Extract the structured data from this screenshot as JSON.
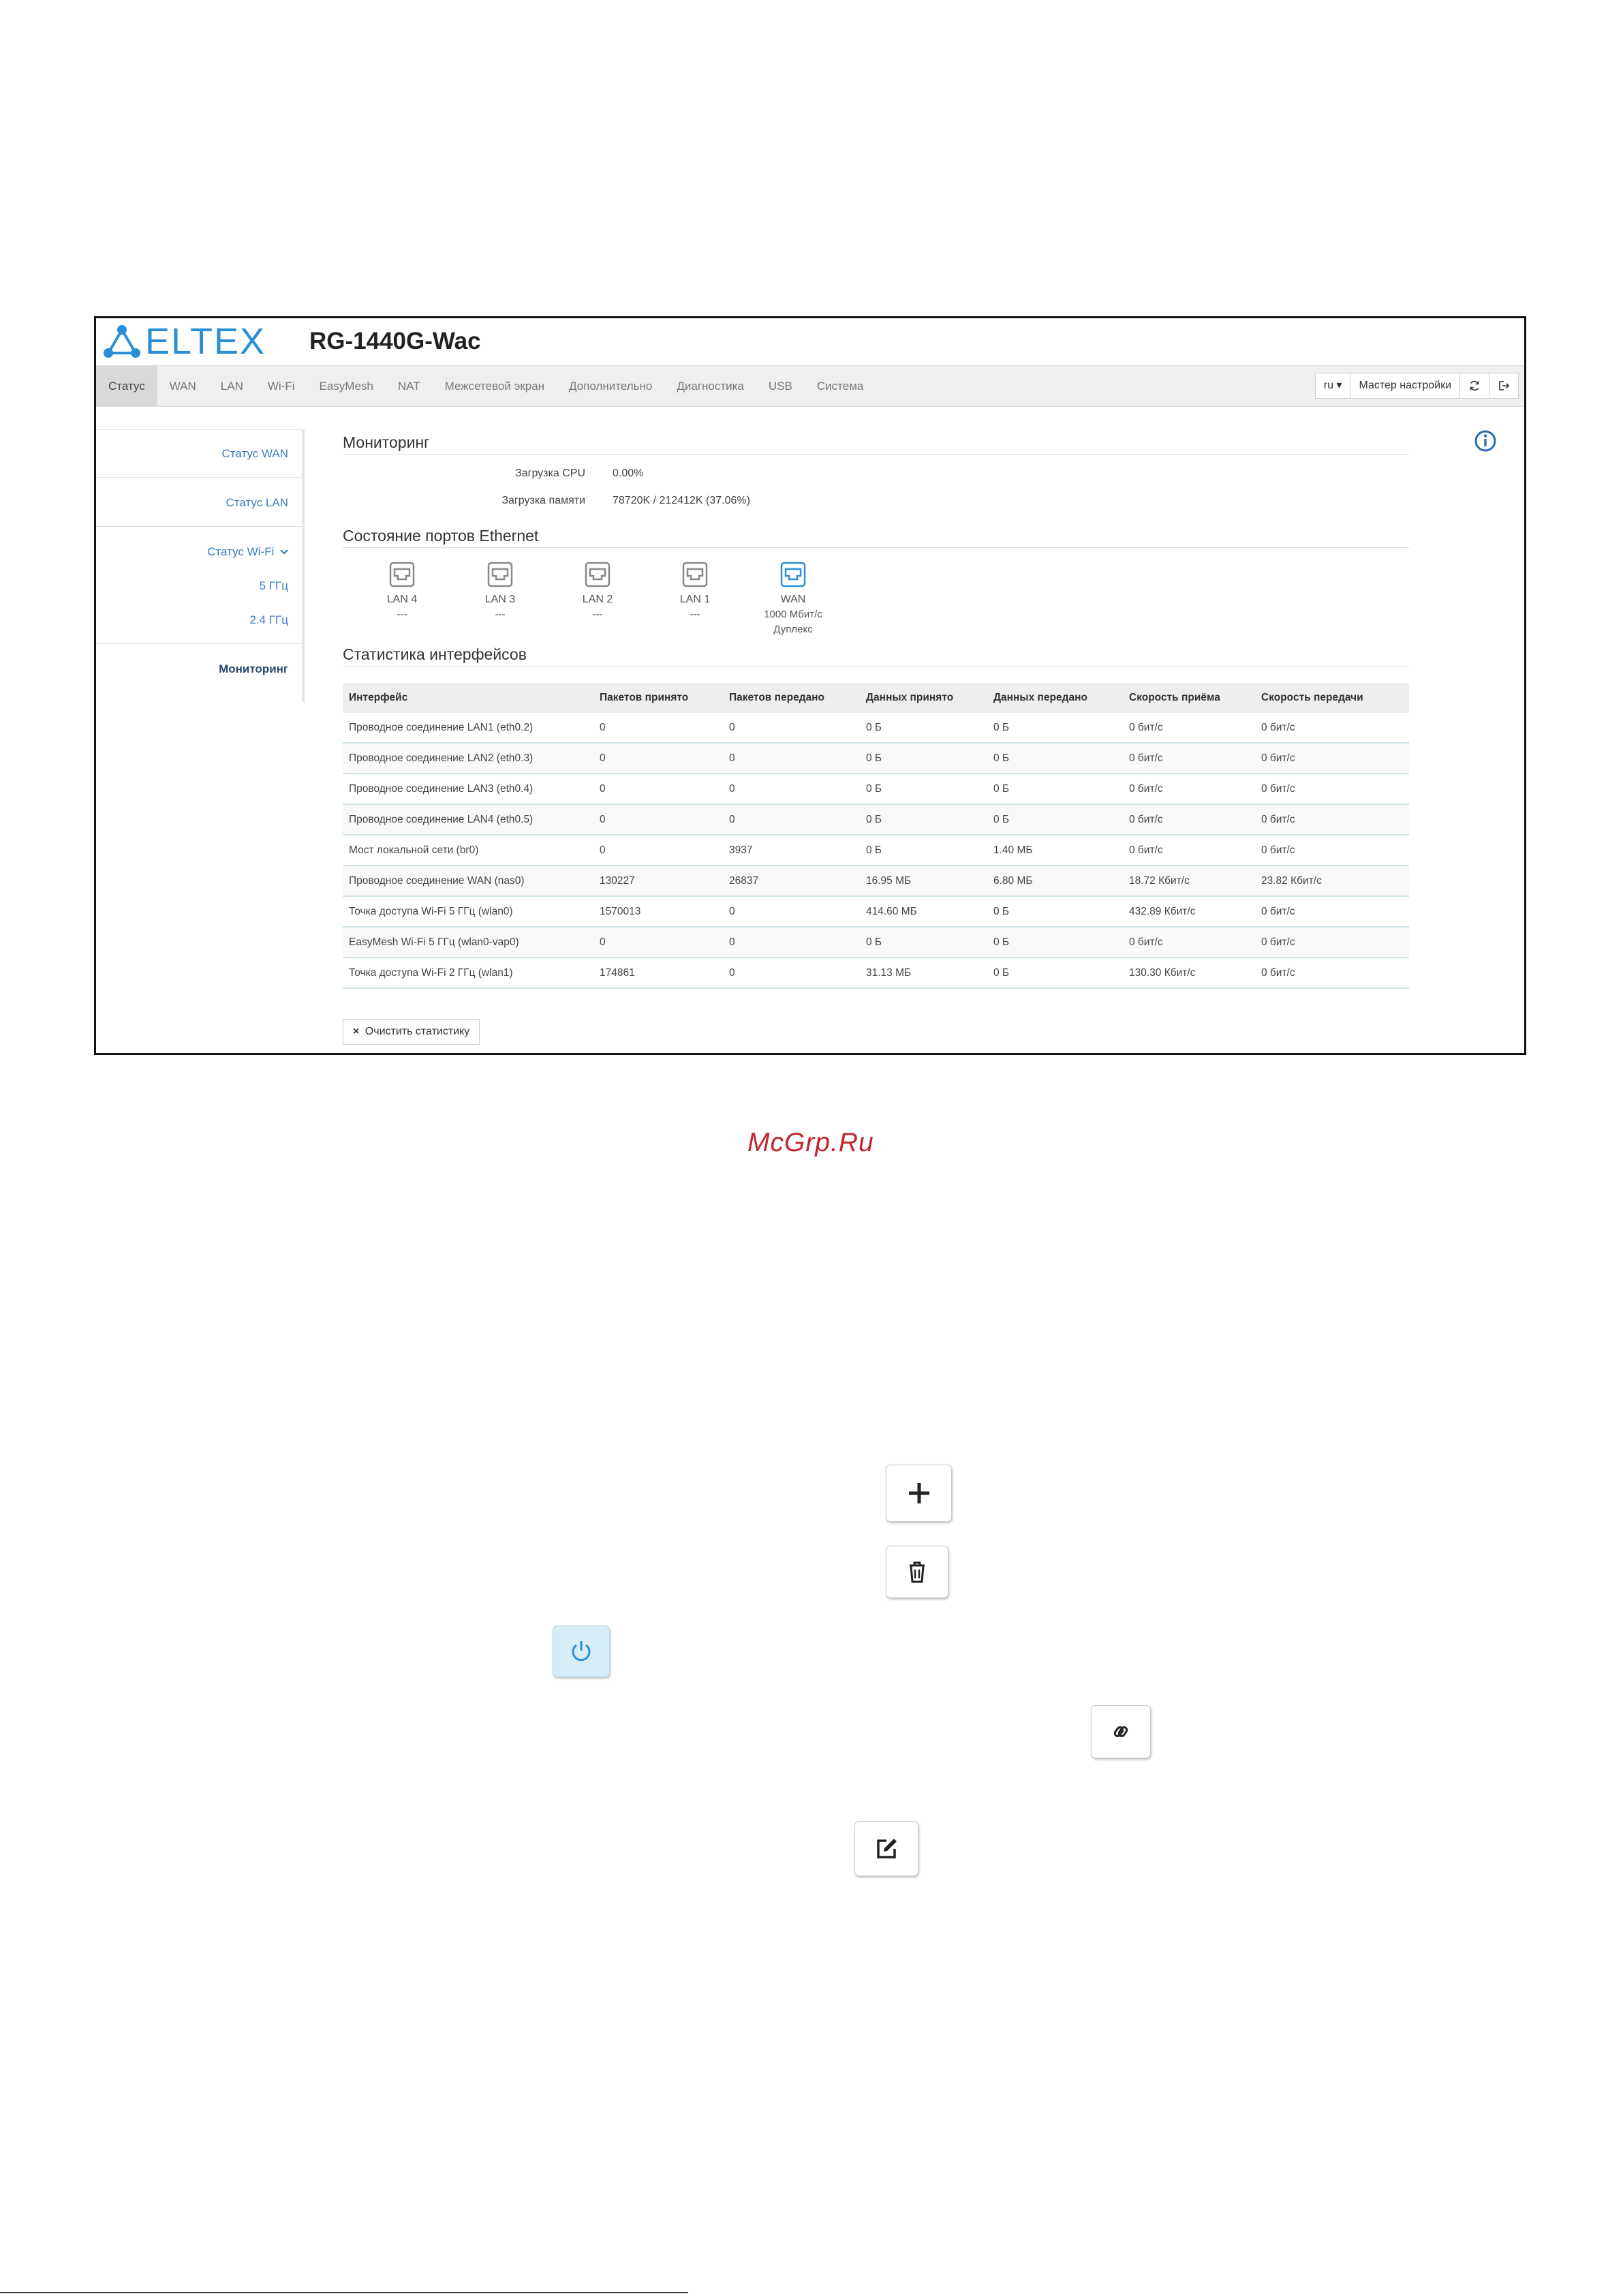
{
  "header": {
    "brand": "ELTEX",
    "model": "RG-1440G-Wac"
  },
  "nav": {
    "items": [
      "Статус",
      "WAN",
      "LAN",
      "Wi-Fi",
      "EasyMesh",
      "NAT",
      "Межсетевой экран",
      "Дополнительно",
      "Диагностика",
      "USB",
      "Система"
    ],
    "active": "Статус",
    "lang": "ru ▾",
    "wizard": "Мастер настройки"
  },
  "sidebar": {
    "wan": "Статус WAN",
    "lan": "Статус LAN",
    "wifi": "Статус Wi-Fi",
    "wifi_5": "5 ГГц",
    "wifi_24": "2.4 ГГц",
    "monitoring": "Мониторинг"
  },
  "monitoring": {
    "title": "Мониторинг",
    "cpu_label": "Загрузка CPU",
    "cpu_value": "0.00%",
    "mem_label": "Загрузка памяти",
    "mem_value": "78720K / 212412K (37.06%)"
  },
  "ports": {
    "title": "Состояние портов Ethernet",
    "items": [
      {
        "name": "LAN 4",
        "line1": "---",
        "line2": "",
        "active": false
      },
      {
        "name": "LAN 3",
        "line1": "---",
        "line2": "",
        "active": false
      },
      {
        "name": "LAN 2",
        "line1": "---",
        "line2": "",
        "active": false
      },
      {
        "name": "LAN 1",
        "line1": "---",
        "line2": "",
        "active": false
      },
      {
        "name": "WAN",
        "line1": "1000 Мбит/с",
        "line2": "Дуплекс",
        "active": true
      }
    ]
  },
  "stats": {
    "title": "Статистика интерфейсов",
    "columns": [
      "Интерфейс",
      "Пакетов принято",
      "Пакетов передано",
      "Данных принято",
      "Данных передано",
      "Скорость приёма",
      "Скорость передачи"
    ],
    "rows": [
      [
        "Проводное соединение LAN1 (eth0.2)",
        "0",
        "0",
        "0 Б",
        "0 Б",
        "0 бит/с",
        "0 бит/с"
      ],
      [
        "Проводное соединение LAN2 (eth0.3)",
        "0",
        "0",
        "0 Б",
        "0 Б",
        "0 бит/с",
        "0 бит/с"
      ],
      [
        "Проводное соединение LAN3 (eth0.4)",
        "0",
        "0",
        "0 Б",
        "0 Б",
        "0 бит/с",
        "0 бит/с"
      ],
      [
        "Проводное соединение LAN4 (eth0.5)",
        "0",
        "0",
        "0 Б",
        "0 Б",
        "0 бит/с",
        "0 бит/с"
      ],
      [
        "Мост локальной сети (br0)",
        "0",
        "3937",
        "0 Б",
        "1.40 МБ",
        "0 бит/с",
        "0 бит/с"
      ],
      [
        "Проводное соединение WAN (nas0)",
        "130227",
        "26837",
        "16.95 МБ",
        "6.80 МБ",
        "18.72 Кбит/с",
        "23.82 Кбит/с"
      ],
      [
        "Точка доступа Wi-Fi 5 ГГц (wlan0)",
        "1570013",
        "0",
        "414.60 МБ",
        "0 Б",
        "432.89 Кбит/с",
        "0 бит/с"
      ],
      [
        "EasyMesh Wi-Fi 5 ГГц (wlan0-vap0)",
        "0",
        "0",
        "0 Б",
        "0 Б",
        "0 бит/с",
        "0 бит/с"
      ],
      [
        "Точка доступа Wi-Fi 2 ГГц (wlan1)",
        "174861",
        "0",
        "31.13 МБ",
        "0 Б",
        "130.30 Кбит/с",
        "0 бит/с"
      ]
    ],
    "clear_button": "Очистить статистику"
  },
  "watermark": "McGrp.Ru",
  "icons": {
    "info": "info-icon",
    "refresh": "refresh-icon",
    "logout": "logout-icon",
    "add": "plus-icon",
    "delete": "trash-icon",
    "power": "power-icon",
    "link": "link-icon",
    "edit": "edit-icon"
  },
  "colors": {
    "brand": "#2a8fd6",
    "link": "#3a7cc0",
    "watermark": "#c0262d"
  }
}
